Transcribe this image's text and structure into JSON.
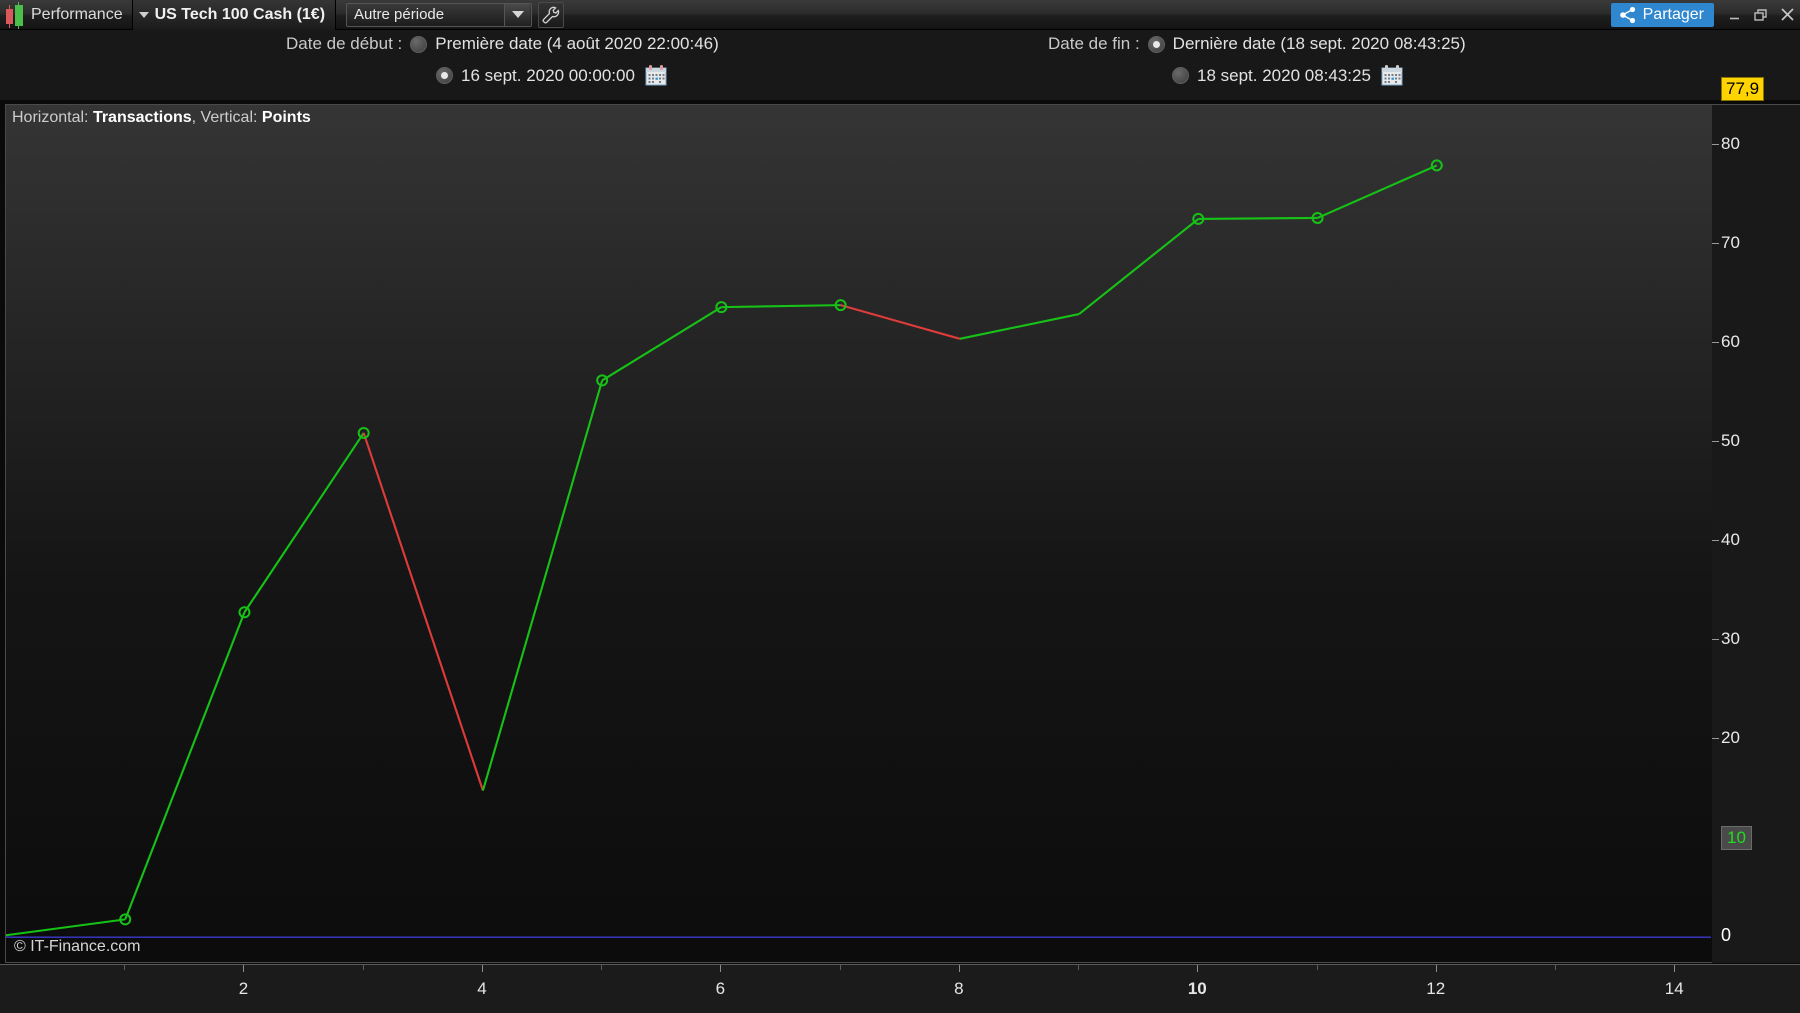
{
  "titlebar": {
    "app_icon": "candlestick-icon",
    "title": "Performance",
    "instrument": "US Tech 100 Cash (1€)",
    "period_select": {
      "value": "Autre période",
      "arrow_icon": "chevron-down-icon"
    },
    "settings_icon": "wrench-icon",
    "share": {
      "label": "Partager",
      "icon": "share-icon",
      "color": "#2f87cf"
    },
    "window_buttons": {
      "minimize": "minimize-icon",
      "restore": "restore-icon",
      "close": "close-icon"
    }
  },
  "dates": {
    "start_label": "Date de début :",
    "start_option_first": {
      "text": "Première date (4 août 2020 22:00:46)",
      "selected": false
    },
    "start_option_custom": {
      "text": "16 sept. 2020 00:00:00",
      "selected": true,
      "icon": "calendar-icon"
    },
    "end_label": "Date de fin :",
    "end_option_last": {
      "text": "Dernière date (18 sept. 2020 08:43:25)",
      "selected": true
    },
    "end_option_custom": {
      "text": "18 sept. 2020 08:43:25",
      "selected": false,
      "icon": "calendar-icon"
    }
  },
  "chart_header": {
    "prefix_h": "Horizontal:",
    "h_value": "Transactions",
    "sep": ", Vertical:",
    "v_value": "Points"
  },
  "copyright": "© IT-Finance.com",
  "chart_data": {
    "type": "line",
    "title": "Performance - US Tech 100 Cash (1€)",
    "xlabel": "Transactions",
    "ylabel": "Points",
    "xlim": [
      0,
      14.3
    ],
    "ylim": [
      -2.5,
      84
    ],
    "grid": false,
    "legend": null,
    "x": [
      1,
      2,
      3,
      4,
      5,
      6,
      7,
      8,
      9,
      10,
      11,
      12
    ],
    "values": [
      1.8,
      32.8,
      50.9,
      14.8,
      56.2,
      63.6,
      63.8,
      60.4,
      62.9,
      72.5,
      72.6,
      77.9
    ],
    "segment_colors": [
      "green",
      "green",
      "red",
      "green",
      "green",
      "green",
      "red",
      "green",
      "green",
      "green",
      "green"
    ],
    "colors": {
      "up": "#17c217",
      "down": "#e03b3b",
      "zero_line": "#3a3ad0"
    },
    "marker_points": [
      1,
      2,
      3,
      5,
      6,
      7,
      10,
      11,
      12
    ],
    "last_value_label": "77,9",
    "start_value_label": "10",
    "zero_label": "0",
    "y_ticks": [
      {
        "label": "80",
        "value": 80
      },
      {
        "label": "70",
        "value": 70
      },
      {
        "label": "60",
        "value": 60
      },
      {
        "label": "50",
        "value": 50
      },
      {
        "label": "40",
        "value": 40
      },
      {
        "label": "30",
        "value": 30
      },
      {
        "label": "20",
        "value": 20
      }
    ],
    "x_ticks": [
      {
        "label": "2",
        "value": 2,
        "bold": false
      },
      {
        "label": "4",
        "value": 4,
        "bold": false
      },
      {
        "label": "6",
        "value": 6,
        "bold": false
      },
      {
        "label": "8",
        "value": 8,
        "bold": false
      },
      {
        "label": "10",
        "value": 10,
        "bold": true
      },
      {
        "label": "12",
        "value": 12,
        "bold": false
      },
      {
        "label": "14",
        "value": 14,
        "bold": false
      }
    ]
  }
}
